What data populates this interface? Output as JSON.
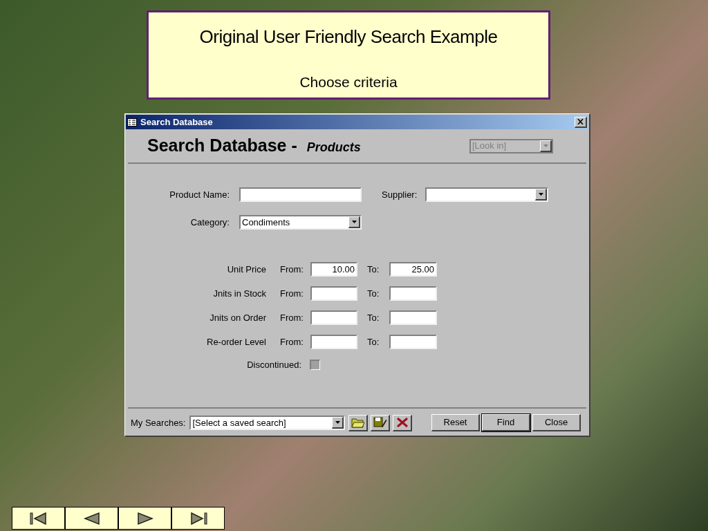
{
  "banner": {
    "title": "Original User Friendly Search Example",
    "subtitle": "Choose criteria"
  },
  "window": {
    "title": "Search Database",
    "heading": "Search Database -",
    "heading_sub": "Products",
    "look_in": {
      "value": "[Look in]",
      "disabled": true
    }
  },
  "product_name": {
    "label": "Product Name:"
  },
  "supplier": {
    "label": "Supplier:"
  },
  "category": {
    "label": "Category:",
    "value": "Condiments"
  },
  "ranges": [
    {
      "label": "Unit Price",
      "from_label": "From:",
      "from": "10.00",
      "to_label": "To:",
      "to": "25.00"
    },
    {
      "label": "Jnits in Stock",
      "from_label": "From:",
      "to_label": "To:"
    },
    {
      "label": "Jnits on Order",
      "from_label": "From:",
      "to_label": "To:"
    },
    {
      "label": "Re-order Level",
      "from_label": "From:",
      "to_label": "To:"
    }
  ],
  "discontinued": {
    "label": "Discontinued:",
    "checked": false,
    "indeterminate": true
  },
  "my_searches": {
    "label": "My Searches:",
    "value": "[Select a saved search]"
  },
  "tools": [
    {
      "kind": "open"
    },
    {
      "kind": "save"
    },
    {
      "kind": "delete"
    }
  ],
  "buttons": [
    {
      "label": "Reset",
      "default": false
    },
    {
      "label": "Find",
      "default": true
    },
    {
      "label": "Close",
      "default": false
    }
  ],
  "nav": [
    {
      "kind": "first"
    },
    {
      "kind": "previous"
    },
    {
      "kind": "next"
    },
    {
      "kind": "last"
    }
  ]
}
